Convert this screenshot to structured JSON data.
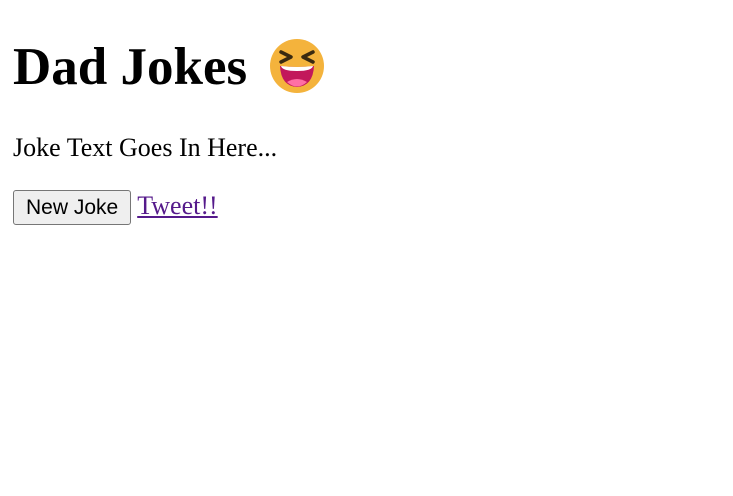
{
  "header": {
    "title": "Dad Jokes",
    "emoji_icon": "grinning-squinting-face-icon"
  },
  "joke": {
    "text": "Joke Text Goes In Here..."
  },
  "actions": {
    "new_joke_label": "New Joke",
    "tweet_label": "Tweet!!"
  },
  "colors": {
    "link_visited": "#551a8b",
    "button_bg": "#efefef",
    "emoji_face": "#f4b33c",
    "emoji_mouth": "#c2185b"
  }
}
